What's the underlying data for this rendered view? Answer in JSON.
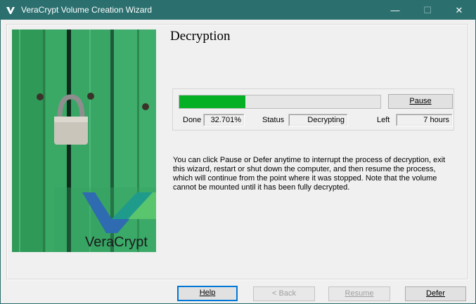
{
  "window": {
    "title": "VeraCrypt Volume Creation Wizard",
    "minimize_label": "—",
    "maximize_label": "☐",
    "close_label": "✕"
  },
  "branding": {
    "logo_text": "VeraCrypt"
  },
  "page": {
    "title": "Decryption",
    "pause_label": "Pause",
    "done_label": "Done",
    "done_value": "32.701%",
    "status_label": "Status",
    "status_value": "Decrypting",
    "left_label": "Left",
    "left_value": "7 hours",
    "progress_percent": 32.701,
    "info_text": "You can click Pause or Defer anytime to interrupt the process of decryption, exit this wizard, restart or shut down the computer, and then resume the process, which will continue from the point where it was stopped. Note that the volume cannot be mounted until it has been fully decrypted."
  },
  "footer": {
    "help_label": "Help",
    "back_label": "< Back",
    "resume_label": "Resume",
    "defer_label": "Defer"
  },
  "colors": {
    "titlebar": "#2b6f6f",
    "progress_fill": "#06b025",
    "focus_border": "#0078d7"
  }
}
